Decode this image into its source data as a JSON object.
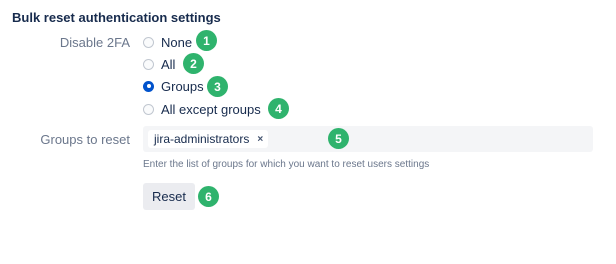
{
  "section": {
    "title": "Bulk reset authentication settings"
  },
  "disable_2fa": {
    "label": "Disable 2FA",
    "options": [
      {
        "label": "None",
        "checked": false,
        "marker": "1"
      },
      {
        "label": "All",
        "checked": false,
        "marker": "2"
      },
      {
        "label": "Groups",
        "checked": true,
        "marker": "3"
      },
      {
        "label": "All except groups",
        "checked": false,
        "marker": "4"
      }
    ]
  },
  "groups_to_reset": {
    "label": "Groups to reset",
    "tags": [
      {
        "label": "jira-administrators",
        "remove_glyph": "×"
      }
    ],
    "marker": "5",
    "help_text": "Enter the list of groups for which you want to reset users settings"
  },
  "reset": {
    "label": "Reset",
    "marker": "6"
  },
  "colors": {
    "accent": "#0052cc",
    "marker_badge": "#2fb36d",
    "label_muted": "#6b778c"
  }
}
